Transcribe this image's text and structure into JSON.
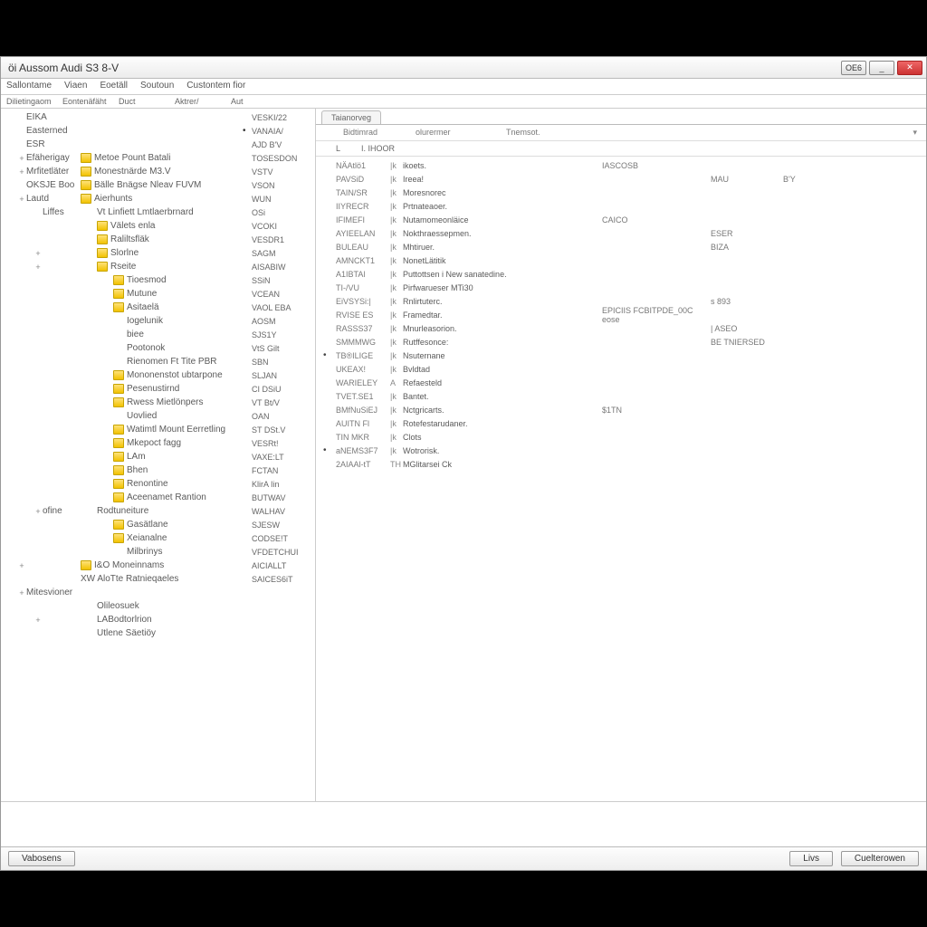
{
  "window": {
    "title": "öi Aussom Audi S3 8-V",
    "buttons": {
      "help": "OE6",
      "min": "_",
      "close": "✕"
    }
  },
  "menubar": [
    "Sallontame",
    "Viaen",
    "Eoetäll",
    "Soutoun",
    "Custontem fior"
  ],
  "toolbar": {
    "items": [
      "Dilietingaom",
      "Eontenäfäht",
      "Duct",
      "Aktrer/",
      "Aut"
    ]
  },
  "tree": [
    {
      "indent": 0,
      "exp": "",
      "label": "EIKA",
      "code": "VESKI/22",
      "ico": false
    },
    {
      "indent": 0,
      "exp": "",
      "label": "Easterned",
      "code": "VANAIA/",
      "ico": false,
      "dot": true
    },
    {
      "indent": 0,
      "exp": "",
      "label": "ESR",
      "code": "AJD B'V",
      "ico": false
    },
    {
      "indent": 0,
      "exp": "+",
      "label": "Efäherigay",
      "code": "TOSESDON",
      "ico": true,
      "sublabel": "Metoe Pount Batali"
    },
    {
      "indent": 0,
      "exp": "+",
      "label": "Mrfitetläter",
      "code": "VSTV",
      "ico": true,
      "sublabel": "Monestnärde M3.V"
    },
    {
      "indent": 0,
      "exp": "",
      "label": "OKSJE Boo",
      "code": "VSON",
      "ico": true,
      "sublabel": "Bälle Bnägse Nleav FUVM"
    },
    {
      "indent": 0,
      "exp": "+",
      "label": "Lautd",
      "code": "WUN",
      "ico": true,
      "sublabel": "Aierhunts"
    },
    {
      "indent": 1,
      "exp": "",
      "label": "Liffes",
      "code": "OSi",
      "ico": false,
      "sublabel": "Vt Linfiett Lmtlaerbrnard"
    },
    {
      "indent": 1,
      "exp": "",
      "label": "",
      "code": "VCOKI",
      "ico": true,
      "sublabel": "Välets enla"
    },
    {
      "indent": 1,
      "exp": "",
      "label": "",
      "code": "VESDR1",
      "ico": true,
      "sublabel": "Raliltsfläk"
    },
    {
      "indent": 1,
      "exp": "+",
      "label": "",
      "code": "SAGM",
      "ico": true,
      "sublabel": "Slorlne"
    },
    {
      "indent": 1,
      "exp": "+",
      "label": "",
      "code": "AISABIW",
      "ico": true,
      "sublabel": "Rseite"
    },
    {
      "indent": 2,
      "exp": "",
      "label": "",
      "code": "SSiN",
      "ico": true,
      "sublabel": "Tioesmod"
    },
    {
      "indent": 2,
      "exp": "",
      "label": "",
      "code": "VCEAN",
      "ico": true,
      "sublabel": "Mutune"
    },
    {
      "indent": 2,
      "exp": "",
      "label": "",
      "code": "VAOL EBA",
      "ico": true,
      "sublabel": "Asitaelä"
    },
    {
      "indent": 2,
      "exp": "",
      "label": "",
      "code": "AOSM",
      "ico": true,
      "sublabel": "Iogelunik",
      "noico": true
    },
    {
      "indent": 2,
      "exp": "",
      "label": "",
      "code": "SJS1Y",
      "ico": true,
      "sublabel": "biee",
      "noico": true
    },
    {
      "indent": 2,
      "exp": "",
      "label": "",
      "code": "VtS Gilt",
      "ico": true,
      "sublabel": "Pootonok",
      "noico": true
    },
    {
      "indent": 2,
      "exp": "",
      "label": "",
      "code": "SBN",
      "ico": true,
      "sublabel": "Rienomen Ft Tite PBR",
      "noico": true
    },
    {
      "indent": 2,
      "exp": "",
      "label": "",
      "code": "SLJAN",
      "ico": true,
      "sublabel": "Mononenstot ubtarpone"
    },
    {
      "indent": 2,
      "exp": "",
      "label": "",
      "code": "CI DSiU",
      "ico": true,
      "sublabel": "Pesenustirnd"
    },
    {
      "indent": 2,
      "exp": "",
      "label": "",
      "code": "VT Bt/V",
      "ico": true,
      "sublabel": "Rwess Mietlönpers"
    },
    {
      "indent": 2,
      "exp": "",
      "label": "",
      "code": "OAN",
      "ico": true,
      "sublabel": "Uovlied",
      "noico": true
    },
    {
      "indent": 2,
      "exp": "",
      "label": "",
      "code": "ST DSt.V",
      "ico": true,
      "sublabel": "Watimtl Mount Eerretling"
    },
    {
      "indent": 2,
      "exp": "",
      "label": "",
      "code": "VESRt!",
      "ico": true,
      "sublabel": "Mkepoct fagg"
    },
    {
      "indent": 2,
      "exp": "",
      "label": "",
      "code": "VAXE:LT",
      "ico": true,
      "sublabel": "LAm"
    },
    {
      "indent": 2,
      "exp": "",
      "label": "",
      "code": "FCTAN",
      "ico": true,
      "sublabel": "Bhen"
    },
    {
      "indent": 2,
      "exp": "",
      "label": "",
      "code": "KlirA Iin",
      "ico": true,
      "sublabel": "Renontine"
    },
    {
      "indent": 2,
      "exp": "",
      "label": "",
      "code": "BUTWAV",
      "ico": true,
      "sublabel": "Aceenamet Rantion"
    },
    {
      "indent": 1,
      "exp": "+",
      "label": "ofine",
      "code": "WALHAV",
      "ico": false,
      "sublabel": "Rodtuneiture"
    },
    {
      "indent": 2,
      "exp": "",
      "label": "",
      "code": "SJESW",
      "ico": true,
      "sublabel": "Gasätlane"
    },
    {
      "indent": 2,
      "exp": "",
      "label": "",
      "code": "CODSE!T",
      "ico": true,
      "sublabel": "Xeianalne"
    },
    {
      "indent": 2,
      "exp": "",
      "label": "",
      "code": "VFDETCHUI",
      "ico": true,
      "sublabel": "Milbrinys",
      "noico": true
    },
    {
      "indent": 0,
      "exp": "+",
      "label": "",
      "code": "AICIALLT",
      "ico": true,
      "sublabel": "I&O Moneinnams"
    },
    {
      "indent": 0,
      "exp": "",
      "label": "",
      "code": "SAICES6iT",
      "ico": false,
      "sublabel": "XW AloTte Ratnieqaeles"
    },
    {
      "indent": 0,
      "exp": "+",
      "label": "Mitesvioner",
      "code": "",
      "ico": false
    },
    {
      "indent": 1,
      "exp": "",
      "label": "",
      "code": "",
      "ico": false,
      "sublabel": "Olileosuek"
    },
    {
      "indent": 1,
      "exp": "+",
      "label": "",
      "code": "",
      "ico": false,
      "sublabel": "LABodtorlrion"
    },
    {
      "indent": 1,
      "exp": "",
      "label": "",
      "code": "",
      "ico": false,
      "sublabel": "Utlene Säetiöy"
    }
  ],
  "right": {
    "tab": "Taianorveg",
    "header": {
      "c1": "Bidtimrad",
      "c2": "olurermer",
      "c3": "Tnemsot."
    },
    "subheader": {
      "c1": "",
      "c2": "I. IHOOR",
      "c3": ""
    },
    "rows": [
      {
        "dot": "",
        "id": "NÄAtlö1",
        "tic": "|k",
        "name": "ikoets.",
        "v1": "IASCOSB",
        "v2": "",
        "v3": ""
      },
      {
        "dot": "",
        "id": "PAVSiD",
        "tic": "|k",
        "name": "Ireea!",
        "v1": "",
        "v2": "MAU",
        "v3": "B'Y"
      },
      {
        "dot": "",
        "id": "TAIN/SR",
        "tic": "|k",
        "name": "Moresnorec",
        "v1": "",
        "v2": "",
        "v3": ""
      },
      {
        "dot": "",
        "id": "IIYRECR",
        "tic": "|k",
        "name": "Prtnateaoer.",
        "v1": "",
        "v2": "",
        "v3": ""
      },
      {
        "dot": "",
        "id": "IFIMEFI",
        "tic": "|k",
        "name": "Nutamomeonläice",
        "v1": "CAICO",
        "v2": "",
        "v3": ""
      },
      {
        "dot": "",
        "id": "AYIEELAN",
        "tic": "|k",
        "name": "Nokthraessepmen.",
        "v1": "",
        "v2": "ESER",
        "v3": ""
      },
      {
        "dot": "",
        "id": "BULEAU",
        "tic": "|k",
        "name": "Mhtiruer.",
        "v1": "",
        "v2": "BIZA",
        "v3": ""
      },
      {
        "dot": "",
        "id": "AMNCKT1",
        "tic": "|k",
        "name": "NonetLätitik",
        "v1": "",
        "v2": "",
        "v3": ""
      },
      {
        "dot": "",
        "id": "A1IBTAl",
        "tic": "|k",
        "name": "Puttottsen i New sanatedine.",
        "v1": "",
        "v2": "",
        "v3": ""
      },
      {
        "dot": "",
        "id": "TI-/VU",
        "tic": "|k",
        "name": "Pirfwarueser MTi30",
        "v1": "",
        "v2": "",
        "v3": ""
      },
      {
        "dot": "",
        "id": "EiVSYSi:|",
        "tic": "|k",
        "name": "Rnlirtuterc.",
        "v1": "",
        "v2": "s 893",
        "v3": ""
      },
      {
        "dot": "",
        "id": "RVISE ES",
        "tic": "|k",
        "name": "Framedtar.",
        "v1": "EPICIIS FCBITPDE_00C  eose",
        "v2": "",
        "v3": ""
      },
      {
        "dot": "",
        "id": "RASSS37",
        "tic": "|k",
        "name": "Mnurleasorion.",
        "v1": "",
        "v2": "| ASEO",
        "v3": ""
      },
      {
        "dot": "",
        "id": "SMMMWG",
        "tic": "|k",
        "name": "Rutffesonce:",
        "v1": "",
        "v2": "BE TNIERSED",
        "v3": ""
      },
      {
        "dot": "•",
        "id": "TB®ILIGE",
        "tic": "|k",
        "name": "Nsuternane",
        "v1": "",
        "v2": "",
        "v3": ""
      },
      {
        "dot": "",
        "id": "UKEAX!",
        "tic": "|k",
        "name": "Bvldtad",
        "v1": "",
        "v2": "",
        "v3": ""
      },
      {
        "dot": "",
        "id": "WARIELEY",
        "tic": "A",
        "name": "Refaesteld",
        "v1": "",
        "v2": "",
        "v3": ""
      },
      {
        "dot": "",
        "id": "TVET.SE1",
        "tic": "|k",
        "name": "Bantet.",
        "v1": "",
        "v2": "",
        "v3": ""
      },
      {
        "dot": "",
        "id": "BMfNuSiEJ",
        "tic": "|k",
        "name": "Nctgricarts.",
        "v1": "$1TN",
        "v2": "",
        "v3": ""
      },
      {
        "dot": "",
        "id": "AUITN Fl",
        "tic": "|k",
        "name": "Rotefestarudaner.",
        "v1": "",
        "v2": "",
        "v3": ""
      },
      {
        "dot": "",
        "id": "TIN MKR",
        "tic": "|k",
        "name": "Clots",
        "v1": "",
        "v2": "",
        "v3": ""
      },
      {
        "dot": "•",
        "id": "aNEMS3F7",
        "tic": "|k",
        "name": "Wotrorisk.",
        "v1": "",
        "v2": "",
        "v3": ""
      },
      {
        "dot": "",
        "id": "2AIAAl-tT",
        "tic": "TH",
        "name": "MGlitarsei Ck",
        "v1": "",
        "v2": "",
        "v3": ""
      }
    ]
  },
  "statusbar": {
    "left": "Vabosens",
    "btn1": "Livs",
    "btn2": "Cuelterowen"
  }
}
